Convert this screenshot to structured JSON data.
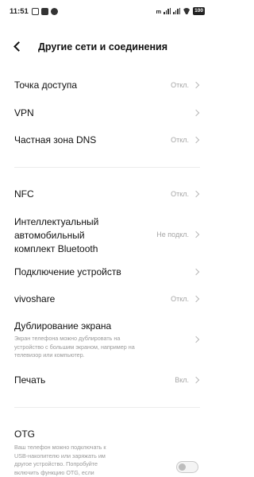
{
  "status_bar": {
    "time": "11:51",
    "right_text": "m",
    "battery": "100"
  },
  "header": {
    "title": "Другие сети и соединения"
  },
  "items": [
    {
      "label": "Точка доступа",
      "value": "Откл."
    },
    {
      "label": "VPN",
      "value": ""
    },
    {
      "label": "Частная зона DNS",
      "value": "Откл."
    },
    {
      "label": "NFC",
      "value": "Откл."
    },
    {
      "label": "Интеллектуальный автомобильный комплект Bluetooth",
      "label_lines": [
        "Интеллектуальный",
        "автомобильный",
        "комплект Bluetooth"
      ],
      "value": "Не подкл."
    },
    {
      "label": "Подключение устройств",
      "value": ""
    },
    {
      "label": "vivoshare",
      "value": "Откл."
    },
    {
      "label": "Дублирование экрана",
      "value": "",
      "subtitle_lines": [
        "Экран телефона можно дублировать на",
        "устройство с большим экраном, например на",
        "телевизор или компьютер."
      ]
    },
    {
      "label": "Печать",
      "value": "Вкл."
    },
    {
      "label": "OTG",
      "value": "",
      "subtitle_lines": [
        "Ваш телефон можно подключать к",
        "USB-накопителю или заряжать им",
        "другое устройство. Попробуйте",
        "включить функцию OTG, если"
      ],
      "toggle_on": false
    }
  ]
}
